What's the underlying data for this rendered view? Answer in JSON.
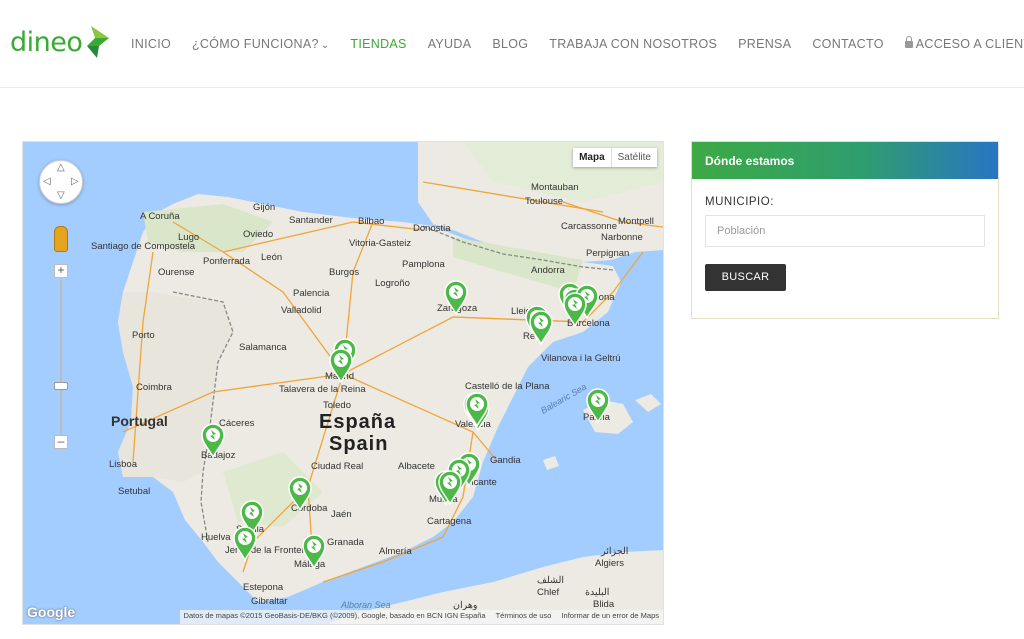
{
  "logo": {
    "text": "dineo"
  },
  "nav": {
    "items": [
      {
        "label": "INICIO",
        "active": false
      },
      {
        "label": "¿CÓMO FUNCIONA?",
        "active": false,
        "dropdown": true
      },
      {
        "label": "TIENDAS",
        "active": true
      },
      {
        "label": "AYUDA",
        "active": false
      },
      {
        "label": "BLOG",
        "active": false
      },
      {
        "label": "TRABAJA CON NOSOTROS",
        "active": false
      },
      {
        "label": "PRENSA",
        "active": false
      },
      {
        "label": "CONTACTO",
        "active": false
      },
      {
        "label": "ACCESO A CLIENTES",
        "active": false,
        "icon": "lock-icon"
      }
    ]
  },
  "map": {
    "type_buttons": {
      "map": "Mapa",
      "satellite": "Satélite",
      "selected": "Mapa"
    },
    "google_logo": "Google",
    "attribution": {
      "data": "Datos de mapas ©2015 GeoBasis-DE/BKG (©2009), Google, basado en BCN IGN España",
      "terms": "Términos de uso",
      "report": "Informar de un error de Maps"
    },
    "country_labels": {
      "es": "España",
      "en": "Spain",
      "portugal": "Portugal"
    },
    "sea_labels": {
      "balearic": "Balearic Sea",
      "alboran": "Alboran Sea"
    },
    "cities": [
      "A Coruña",
      "Gijón",
      "Santander",
      "Bilbao",
      "Donostia",
      "Lugo",
      "Oviedo",
      "Vitoria-Gasteiz",
      "Santiago de Compostela",
      "Ponferrada",
      "León",
      "Burgos",
      "Pamplona",
      "Logroño",
      "Ourense",
      "Palencia",
      "Valladolid",
      "Zaragoza",
      "Porto",
      "Salamanca",
      "Madrid",
      "Toledo",
      "Talavera de la Reina",
      "Coimbra",
      "Cáceres",
      "Badajoz",
      "Lisboa",
      "Setubal",
      "Ciudad Real",
      "Albacete",
      "Valencia",
      "Castelló de la Plana",
      "Gandia",
      "Alicante",
      "Murcia",
      "Cartagena",
      "Córdoba",
      "Jaén",
      "Sevilla",
      "Huelva",
      "Granada",
      "Málaga",
      "Jerez de la Frontera",
      "Estepona",
      "Gibraltar",
      "Almería",
      "Reus",
      "Barcelona",
      "Girona",
      "Lleida",
      "Andorra",
      "Perpignan",
      "Toulouse",
      "Montauban",
      "Carcassonne",
      "Narbonne",
      "Montpell",
      "Palma",
      "Vilanova i la Geltrú",
      "Algiers",
      "Chlef",
      "Blida"
    ],
    "arabic_labels": {
      "algiers": "الجزائر",
      "chlef": "الشلف",
      "blida": "البليدة",
      "oran": "وهران"
    },
    "store_count": 22
  },
  "panel": {
    "title": "Dónde estamos",
    "field_label": "MUNICIPIO:",
    "field_placeholder": "Población",
    "button_label": "BUSCAR"
  },
  "colors": {
    "brand_green": "#3aaa35",
    "pin_green": "#4cb848",
    "panel_gradient_end": "#2875c2",
    "button_dark": "#333333"
  }
}
